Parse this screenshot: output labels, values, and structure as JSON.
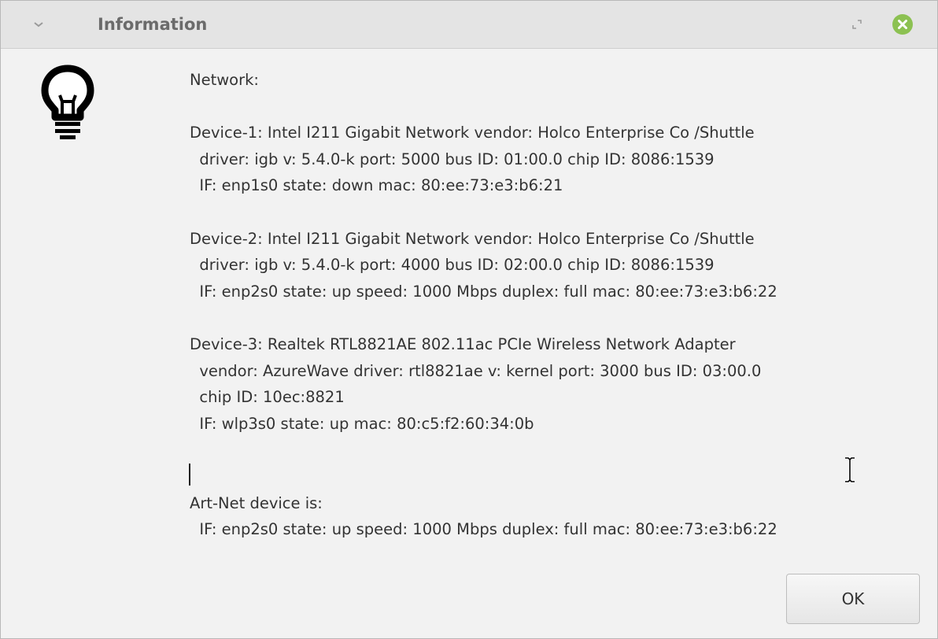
{
  "window": {
    "title": "Information"
  },
  "icons": {
    "menu": "chevron-down-icon",
    "restore": "restore-icon",
    "close": "close-icon",
    "info": "lightbulb-icon",
    "cursor": "ibeam-cursor-icon"
  },
  "colors": {
    "close_button": "#8cc152",
    "title_text": "#6b6b6b",
    "body_text": "#333333"
  },
  "message": "Network:\n\nDevice-1: Intel I211 Gigabit Network vendor: Holco Enterprise Co /Shuttle\n  driver: igb v: 5.4.0-k port: 5000 bus ID: 01:00.0 chip ID: 8086:1539\n  IF: enp1s0 state: down mac: 80:ee:73:e3:b6:21\n\nDevice-2: Intel I211 Gigabit Network vendor: Holco Enterprise Co /Shuttle\n  driver: igb v: 5.4.0-k port: 4000 bus ID: 02:00.0 chip ID: 8086:1539\n  IF: enp2s0 state: up speed: 1000 Mbps duplex: full mac: 80:ee:73:e3:b6:22\n\nDevice-3: Realtek RTL8821AE 802.11ac PCIe Wireless Network Adapter\n  vendor: AzureWave driver: rtl8821ae v: kernel port: 3000 bus ID: 03:00.0\n  chip ID: 10ec:8821\n  IF: wlp3s0 state: up mac: 80:c5:f2:60:34:0b\n\n\nArt-Net device is:\n  IF: enp2s0 state: up speed: 1000 Mbps duplex: full mac: 80:ee:73:e3:b6:22",
  "buttons": {
    "ok": "OK"
  }
}
